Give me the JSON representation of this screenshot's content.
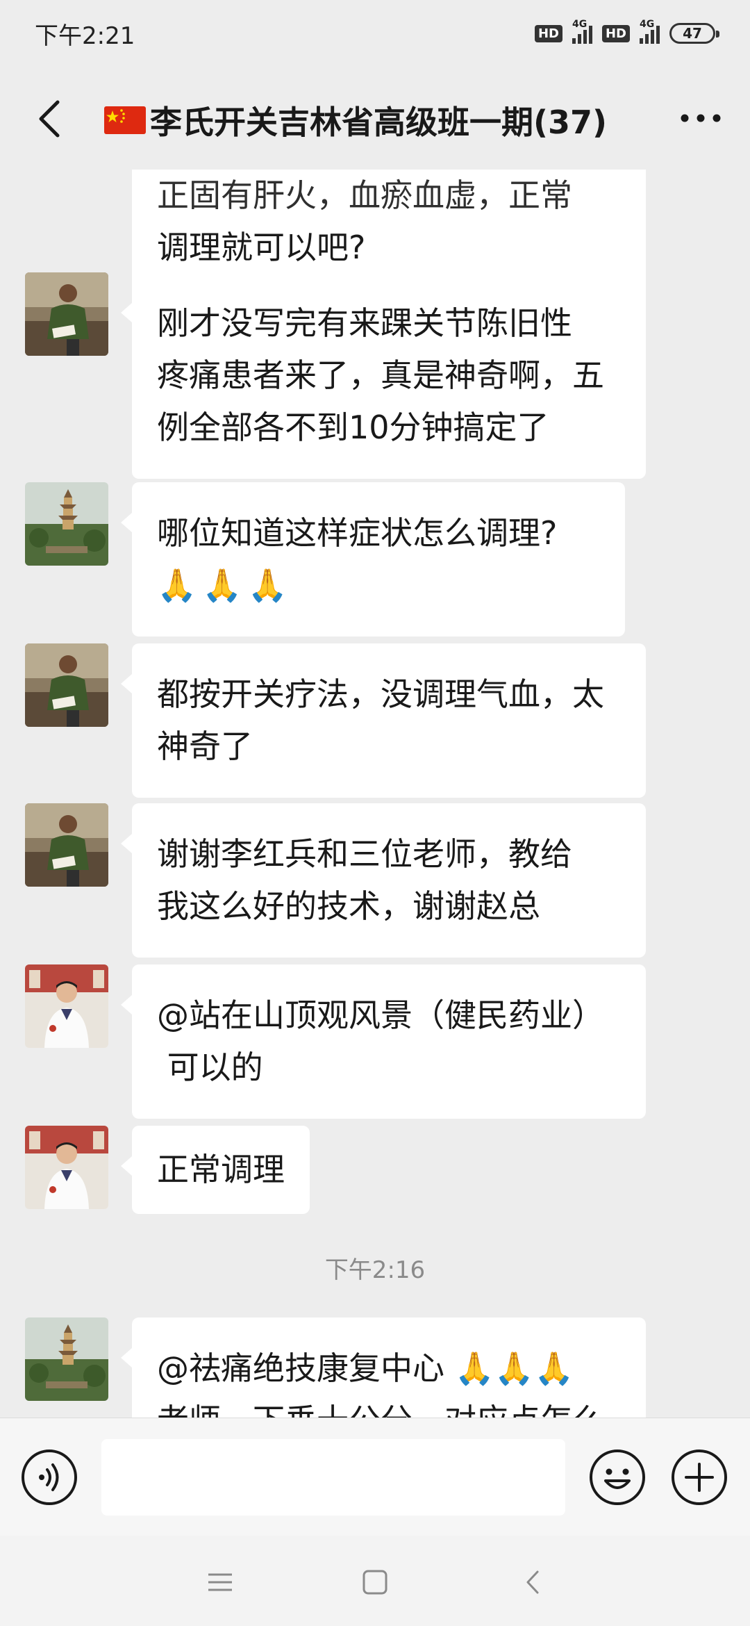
{
  "status_bar": {
    "time": "下午2:21",
    "hd_label": "HD",
    "network_label": "4G",
    "battery": "47"
  },
  "header": {
    "title": "李氏开关吉林省高级班一期(37)",
    "flag_icon": "china-flag-icon",
    "back_icon": "chevron-left-icon",
    "more_icon": "more-dots-icon"
  },
  "messages": [
    {
      "partial_top": "正固有肝火，血瘀血虚，正常",
      "line": "调理就可以吧?"
    },
    {
      "avatar": "man-reading-avatar",
      "lines": [
        "刚才没写完有来踝关节陈旧性",
        "疼痛患者来了，真是神奇啊，五",
        "例全部各不到10分钟搞定了"
      ]
    },
    {
      "avatar": "pagoda-avatar",
      "lines": [
        "哪位知道这样症状怎么调理?"
      ],
      "emojis": [
        "🙏",
        "🙏",
        "🙏"
      ]
    },
    {
      "avatar": "man-reading-avatar",
      "lines": [
        "都按开关疗法，没调理气血，太",
        "神奇了"
      ]
    },
    {
      "avatar": "man-reading-avatar",
      "lines": [
        "谢谢李红兵和三位老师，教给",
        "我这么好的技术，谢谢赵总"
      ]
    },
    {
      "avatar": "doctor-avatar",
      "lines": [
        "@站在山顶观风景（健民药业）",
        " 可以的"
      ]
    },
    {
      "avatar": "doctor-avatar",
      "lines": [
        "正常调理"
      ]
    },
    {
      "avatar": "pagoda-avatar",
      "lines": [
        "@祛痛绝技康复中心 ",
        "老师，下垂十公分，对应点怎么"
      ],
      "emojis": [
        "🙏",
        "🙏",
        "🙏"
      ]
    }
  ],
  "time_divider": "下午2:16",
  "input_bar": {
    "voice_icon": "voice-icon",
    "emoji_icon": "emoji-smile-icon",
    "plus_icon": "plus-icon",
    "placeholder": ""
  },
  "nav_bar": {
    "menu_icon": "menu-icon",
    "home_icon": "home-square-icon",
    "back_icon": "back-triangle-icon"
  },
  "colors": {
    "background": "#ededed",
    "bubble": "#ffffff",
    "text": "#191919",
    "timestamp": "#8a8a8a"
  }
}
